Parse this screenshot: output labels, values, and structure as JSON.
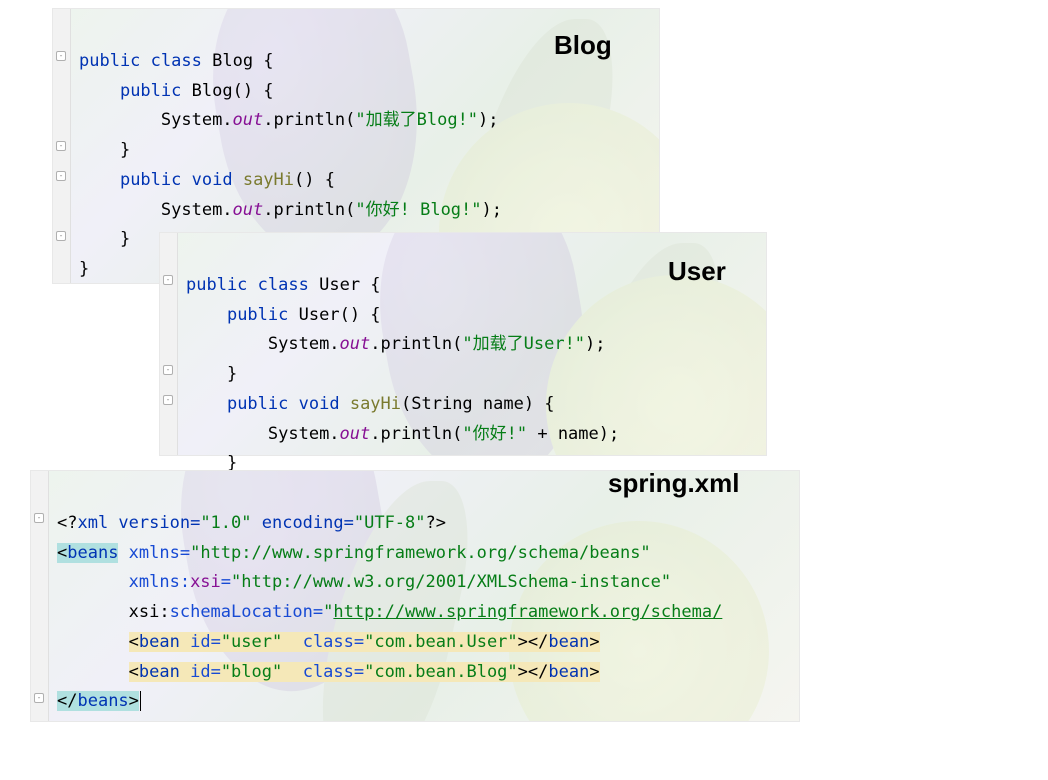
{
  "labels": {
    "blog": "Blog",
    "user": "User",
    "spring": "spring.xml"
  },
  "blog": {
    "l1_kw1": "public",
    "l1_kw2": "class",
    "l1_cls": "Blog",
    "l1_brace": " {",
    "l2_kw": "public",
    "l2_ctor": "Blog",
    "l2_parens": "() {",
    "l3_sys": "System.",
    "l3_out": "out",
    "l3_dot": ".println(",
    "l3_str": "\"加载了Blog!\"",
    "l3_end": ");",
    "l4_brace": "}",
    "l5_kw1": "public",
    "l5_kw2": "void",
    "l5_mth": "sayHi",
    "l5_parens": "() {",
    "l6_sys": "System.",
    "l6_out": "out",
    "l6_dot": ".println(",
    "l6_str": "\"你好! Blog!\"",
    "l6_end": ");",
    "l7_brace": "}",
    "l8_brace": "}"
  },
  "user": {
    "l1_kw1": "public",
    "l1_kw2": "class",
    "l1_cls": "User",
    "l1_brace": " {",
    "l2_kw": "public",
    "l2_ctor": "User",
    "l2_parens": "() {",
    "l3_sys": "System.",
    "l3_out": "out",
    "l3_dot": ".println(",
    "l3_str": "\"加载了User!\"",
    "l3_end": ");",
    "l4_brace": "}",
    "l5_kw1": "public",
    "l5_kw2": "void",
    "l5_mth": "sayHi",
    "l5_param": "(String name) {",
    "l6_sys": "System.",
    "l6_out": "out",
    "l6_dot": ".println(",
    "l6_str": "\"你好!\"",
    "l6_plus": " + name);",
    "l7_brace": "}"
  },
  "xml": {
    "l1_open": "<?",
    "l1_xml": "xml version=",
    "l1_ver": "\"1.0\"",
    "l1_enc": " encoding=",
    "l1_utf": "\"UTF-8\"",
    "l1_close": "?>",
    "l2_open": "<",
    "l2_tag": "beans",
    "l2_a1n": " xmlns=",
    "l2_a1v": "\"http://www.springframework.org/schema/beans\"",
    "l3_nsp": "       xmlns:",
    "l3_nsn": "xsi",
    "l3_eq": "=",
    "l3_val": "\"http://www.w3.org/2001/XMLSchema-instance\"",
    "l4_ns": "       xsi",
    "l4_colon": ":",
    "l4_attr": "schemaLocation",
    "l4_eq": "=",
    "l4_q": "\"",
    "l4_url": "http://www.springframework.org/schema/",
    "l5_indent": "       ",
    "l5_open": "<",
    "l5_tag": "bean",
    "l5_id": " id=",
    "l5_idv": "\"user\"",
    "l5_cls": "  class=",
    "l5_clsv": "\"com.bean.User\"",
    "l5_gt": ">",
    "l5_co": "</",
    "l5_ct": "bean",
    "l5_cg": ">",
    "l6_indent": "       ",
    "l6_open": "<",
    "l6_tag": "bean",
    "l6_id": " id=",
    "l6_idv": "\"blog\"",
    "l6_cls": "  class=",
    "l6_clsv": "\"com.bean.Blog\"",
    "l6_gt": ">",
    "l6_co": "</",
    "l6_ct": "bean",
    "l6_cg": ">",
    "l7_open": "</",
    "l7_tag": "beans",
    "l7_gt": ">"
  }
}
